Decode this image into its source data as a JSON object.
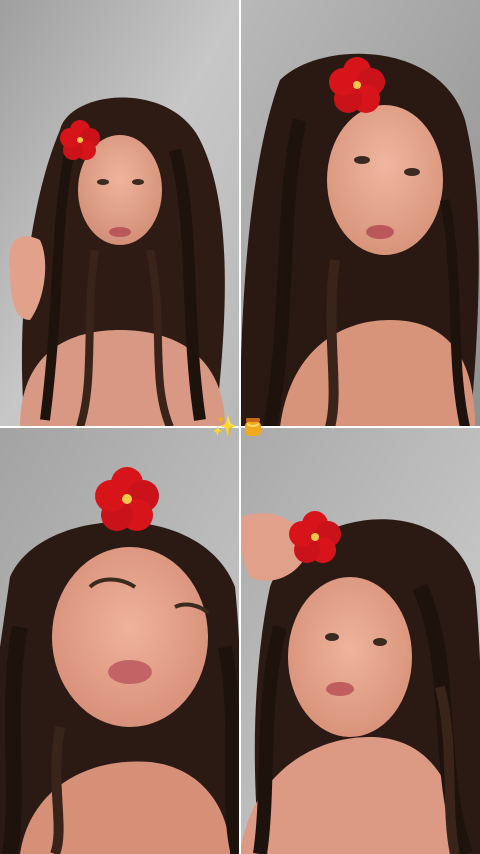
{
  "photos": [
    {
      "subject": "portrait-1"
    },
    {
      "subject": "portrait-2"
    },
    {
      "subject": "portrait-3"
    },
    {
      "subject": "portrait-4"
    }
  ],
  "stickers": {
    "sparkles_glyph": "✨",
    "honey_icon": "honey-pot-icon"
  },
  "colors": {
    "wall": "#c9cac9",
    "hair": "#2b1a14",
    "skin": "#e3a18a",
    "flower": "#d8141b"
  }
}
